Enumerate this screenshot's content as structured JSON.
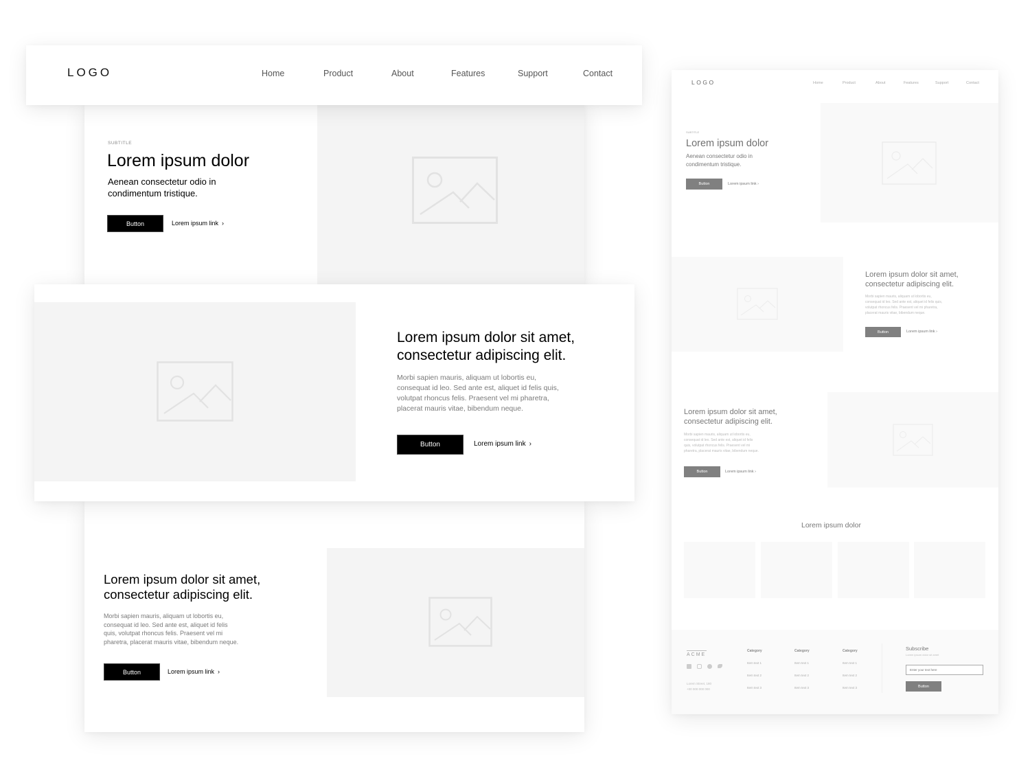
{
  "main": {
    "header": {
      "logo": "LOGO",
      "nav": [
        "Home",
        "Product",
        "About",
        "Features",
        "Support",
        "Contact"
      ]
    },
    "hero": {
      "subtitle": "SUBTITLE",
      "title": "Lorem ipsum dolor",
      "lead_line1": "Aenean consectetur odio in",
      "lead_line2": "condimentum tristique.",
      "button": "Button",
      "link": "Lorem ipsum link",
      "chevron": "›"
    },
    "feature1": {
      "title_line1": "Lorem ipsum dolor sit amet,",
      "title_line2": "consectetur adipiscing elit.",
      "body": [
        "Morbi sapien mauris, aliquam ut lobortis eu,",
        "consequat id leo. Sed ante est, aliquet id felis quis,",
        "volutpat rhoncus felis. Praesent vel mi pharetra,",
        "placerat mauris vitae, bibendum neque."
      ],
      "button": "Button",
      "link": "Lorem ipsum link",
      "chevron": "›"
    },
    "feature2": {
      "title_line1": "Lorem ipsum dolor sit amet,",
      "title_line2": "consectetur adipiscing elit.",
      "body": [
        "Morbi sapien mauris, aliquam ut lobortis eu,",
        "consequat id leo. Sed ante est, aliquet id felis",
        "quis, volutpat rhoncus felis. Praesent vel mi",
        "pharetra, placerat mauris vitae, bibendum neque."
      ],
      "button": "Button",
      "link": "Lorem ipsum link",
      "chevron": "›"
    }
  },
  "mini": {
    "header": {
      "logo": "LOGO",
      "nav": [
        "Home",
        "Product",
        "About",
        "Features",
        "Support",
        "Contact"
      ]
    },
    "hero": {
      "subtitle": "SUBTITLE",
      "title": "Lorem ipsum dolor",
      "lead_line1": "Aenean consectetur odio in",
      "lead_line2": "condimentum tristique.",
      "button": "Button",
      "link": "Lorem ipsum link ›"
    },
    "feature1": {
      "title_line1": "Lorem ipsum dolor sit amet,",
      "title_line2": "consectetur adipiscing elit.",
      "body": [
        "Morbi sapien mauris, aliquam ut lobortis eu,",
        "consequat id leo. Sed ante est, aliquet id felis quis,",
        "volutpat rhoncus felis. Praesent vel mi pharetra,",
        "placerat mauris vitae, bibendum neque."
      ],
      "button": "Button",
      "link": "Lorem ipsum link ›"
    },
    "feature2": {
      "title_line1": "Lorem ipsum dolor sit amet,",
      "title_line2": "consectetur adipiscing elit.",
      "body": [
        "Morbi sapien mauris, aliquam ut lobortis eu,",
        "consequat id leo. Sed ante est, aliquet id felis",
        "quis, volutpat rhoncus felis. Praesent vel mi",
        "pharetra, placerat mauris vitae, bibendum neque."
      ],
      "button": "Button",
      "link": "Lorem ipsum link ›"
    },
    "gallery": {
      "title": "Lorem ipsum dolor"
    },
    "footer": {
      "brand": "ACME",
      "social_icons": [
        "linkedin-icon",
        "instagram-icon",
        "facebook-icon",
        "twitter-icon"
      ],
      "address_line1": "Lorem Street, 180",
      "address_line2": "+00 000 000 000",
      "columns": [
        {
          "heading": "Category",
          "items": [
            "Item text 1",
            "Item text 2",
            "Item text 3"
          ]
        },
        {
          "heading": "Category",
          "items": [
            "Item text 1",
            "Item text 2",
            "Item text 3"
          ]
        },
        {
          "heading": "Category",
          "items": [
            "Item text 1",
            "Item text 2",
            "Item text 3"
          ]
        }
      ],
      "subscribe": {
        "title": "Subscribe",
        "subtitle": "Lorem ipsum dolor sit amet",
        "placeholder": "Enter your text here",
        "button": "Button"
      }
    }
  }
}
